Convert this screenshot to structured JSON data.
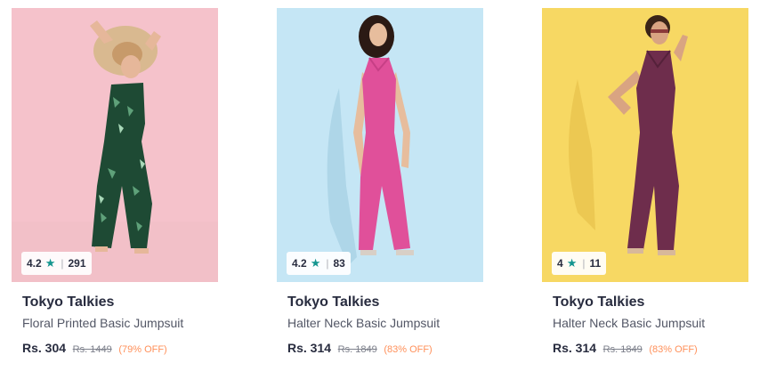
{
  "products": [
    {
      "rating": "4.2",
      "rating_count": "291",
      "brand": "Tokyo Talkies",
      "name": "Floral Printed Basic Jumpsuit",
      "price": "Rs. 304",
      "mrp": "Rs. 1449",
      "discount": "(79% OFF)",
      "image": "model-floral-jumpsuit-photo",
      "bg_color": "#f6c9d0",
      "outfit_color": "#1e4a34"
    },
    {
      "rating": "4.2",
      "rating_count": "83",
      "brand": "Tokyo Talkies",
      "name": "Halter Neck Basic Jumpsuit",
      "price": "Rs. 314",
      "mrp": "Rs. 1849",
      "discount": "(83% OFF)",
      "image": "model-pink-jumpsuit-photo",
      "bg_color": "#bfe3f3",
      "outfit_color": "#e0509a"
    },
    {
      "rating": "4",
      "rating_count": "11",
      "brand": "Tokyo Talkies",
      "name": "Halter Neck Basic Jumpsuit",
      "price": "Rs. 314",
      "mrp": "Rs. 1849",
      "discount": "(83% OFF)",
      "image": "model-plum-jumpsuit-photo",
      "bg_color": "#f8dc6a",
      "outfit_color": "#6e2d4c"
    }
  ],
  "icons": {
    "rating_star": "star-icon"
  },
  "colors": {
    "star": "#14958f",
    "discount": "#ff905a"
  }
}
